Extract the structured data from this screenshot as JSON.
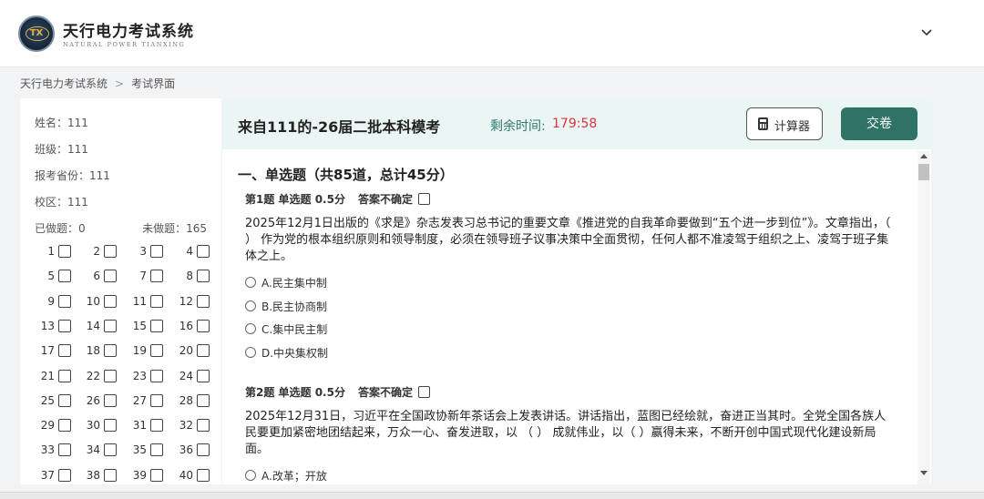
{
  "brand": {
    "title": "天行电力考试系统",
    "subtitle": "NATURAL POWER TIANXING",
    "logo_text": "TX"
  },
  "header": {
    "toggle_icon": "chevron-down-icon"
  },
  "breadcrumb": {
    "home": "天行电力考试系统",
    "separator": ">",
    "current": "考试界面"
  },
  "student": {
    "name": "姓名：111",
    "class": "班级：111",
    "province": "报考省份：111",
    "campus": "校区：111",
    "done": "已做题：0",
    "todo": "未做题：165"
  },
  "question_nav": [
    "1",
    "2",
    "3",
    "4",
    "5",
    "6",
    "7",
    "8",
    "9",
    "10",
    "11",
    "12",
    "13",
    "14",
    "15",
    "16",
    "17",
    "18",
    "19",
    "20",
    "21",
    "22",
    "23",
    "24",
    "25",
    "26",
    "27",
    "28",
    "29",
    "30",
    "31",
    "32",
    "33",
    "34",
    "35",
    "36",
    "37",
    "38",
    "39",
    "40"
  ],
  "exam": {
    "title": "来自111的-26届二批本科模考",
    "timer_label": "剩余时间:",
    "timer_value": "179:58",
    "calculator_label": "计算器",
    "submit_label": "交卷"
  },
  "section": {
    "title": "一、单选题（共85道，总计45分）"
  },
  "questions": [
    {
      "head": "第1题 单选题 0.5分",
      "flag_label": "答案不确定",
      "text": "2025年12月1日出版的《求是》杂志发表习总书记的重要文章《推进党的自我革命要做到“五个进一步到位”》。文章指出，（ ） 作为党的根本组织原则和领导制度，必须在领导班子议事决策中全面贯彻，任何人都不准凌驾于组织之上、凌驾于班子集体之上。",
      "options": [
        "A.民主集中制",
        "B.民主协商制",
        "C.集中民主制",
        "D.中央集权制"
      ]
    },
    {
      "head": "第2题 单选题 0.5分",
      "flag_label": "答案不确定",
      "text": "2025年12月31日，习近平在全国政协新年茶话会上发表讲话。讲话指出，蓝图已经绘就，奋进正当其时。全党全国各族人民要更加紧密地团结起来，万众一心、奋发进取，以 （ ） 成就伟业，以（ ）赢得未来，不断开创中国式现代化建设新局面。",
      "options": [
        "A.改革；开放"
      ]
    }
  ],
  "colors": {
    "accent": "#2f7366",
    "timer": "#d9363e",
    "header_bg": "#eaf5f4"
  }
}
